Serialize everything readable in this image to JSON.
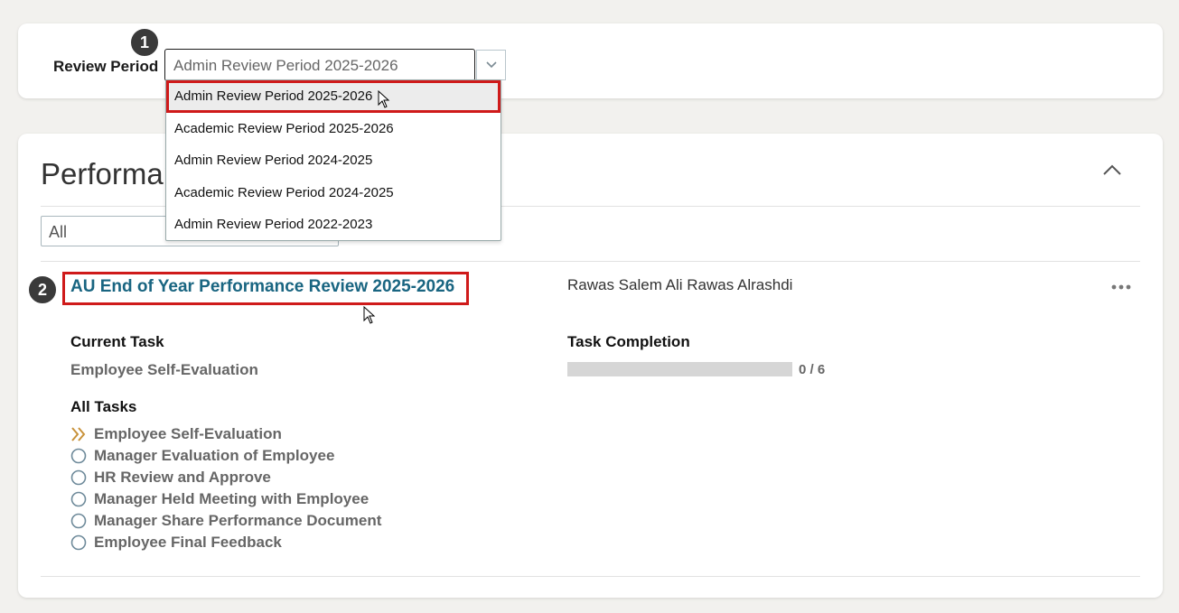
{
  "review_period": {
    "label": "Review Period",
    "selected_value": "Admin Review Period 2025-2026",
    "options": [
      "Admin Review Period 2025-2026",
      "Academic Review Period 2025-2026",
      "Admin Review Period 2024-2025",
      "Academic Review Period 2024-2025",
      "Admin Review Period 2022-2023"
    ]
  },
  "steps": {
    "one": "1",
    "two": "2"
  },
  "performance": {
    "title": "Performance",
    "filter_value": "All"
  },
  "document": {
    "name": "AU End of Year Performance Review 2025-2026",
    "person": "Rawas Salem Ali Rawas Alrashdi",
    "current_task_label": "Current Task",
    "current_task": "Employee Self-Evaluation",
    "task_completion_label": "Task Completion",
    "completion_text": "0 / 6",
    "completion_fraction": 0,
    "all_tasks_label": "All Tasks",
    "tasks": [
      "Employee Self-Evaluation",
      "Manager Evaluation of Employee",
      "HR Review and Approve",
      "Manager Held Meeting with Employee",
      "Manager Share Performance Document",
      "Employee Final Feedback"
    ]
  },
  "colors": {
    "link": "#196581",
    "highlight": "#cf1a1a",
    "current_task_icon": "#c8923a",
    "task_circle": "#6e8a9a"
  },
  "icons": {
    "dropdown": "chevron-down-icon",
    "collapse": "chevron-up-icon",
    "more": "more-horizontal-icon",
    "current": "double-chevron-right-icon",
    "pending": "circle-outline-icon"
  }
}
